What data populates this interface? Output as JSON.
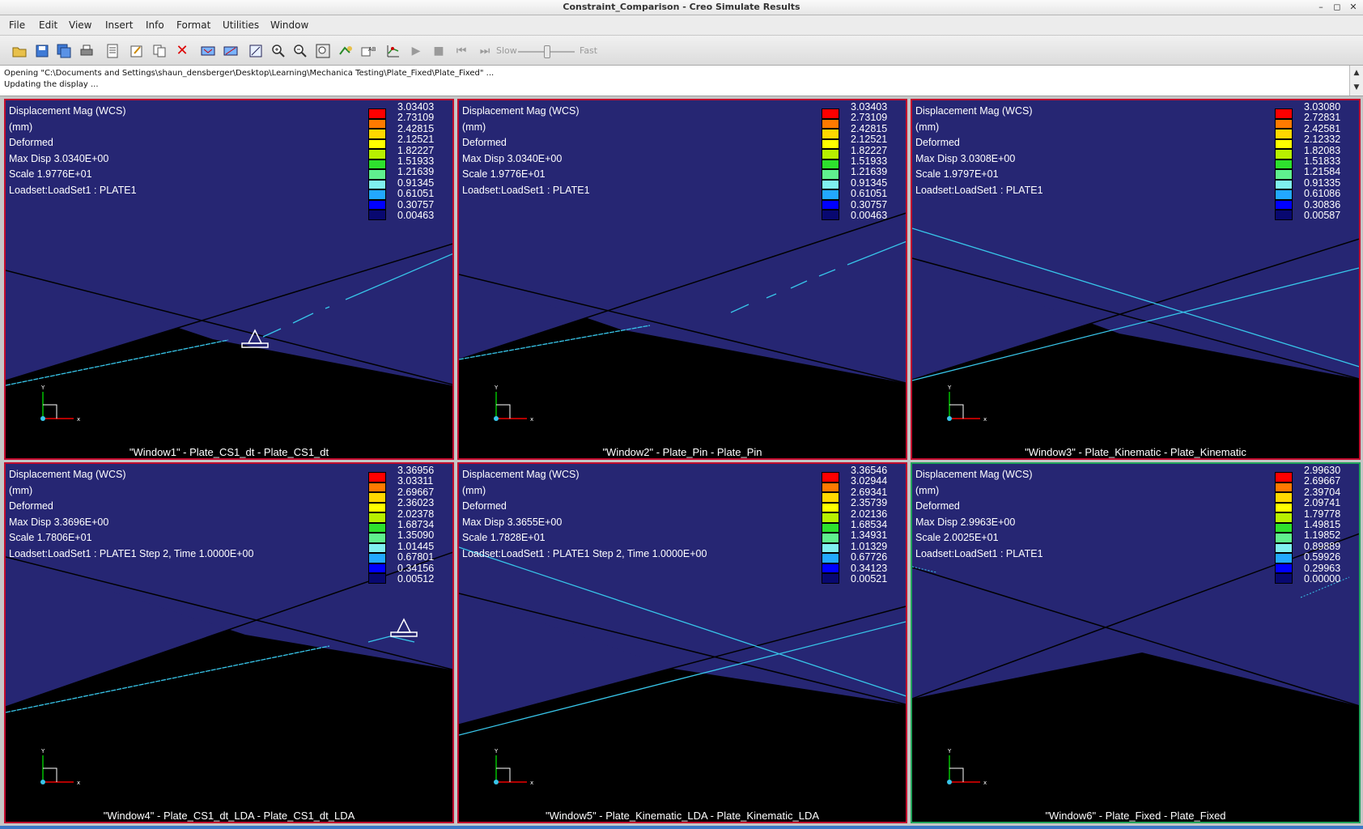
{
  "window": {
    "title": "Constraint_Comparison - Creo Simulate Results",
    "minimize": "–",
    "maximize": "◻",
    "close": "✕"
  },
  "menu": [
    "File",
    "Edit",
    "View",
    "Insert",
    "Info",
    "Format",
    "Utilities",
    "Window"
  ],
  "toolbar": {
    "slow_label": "Slow",
    "fast_label": "Fast",
    "icons": [
      "open-icon",
      "save-icon",
      "save-all-icon",
      "print-icon",
      "report-icon",
      "edit-definition-icon",
      "copy-icon",
      "delete-icon",
      "query-icon",
      "dynamic-query-icon",
      "info-icon",
      "zoom-in-icon",
      "zoom-out-icon",
      "refit-icon",
      "view-icon",
      "annotation-icon",
      "graph-icon",
      "play-icon",
      "stop-icon",
      "step-back-icon",
      "step-forward-icon"
    ]
  },
  "messages": [
    "Opening \"C:\\Documents and Settings\\shaun_densberger\\Desktop\\Learning\\Mechanica Testing\\Plate_Fixed\\Plate_Fixed\" ...",
    "Updating the display ..."
  ],
  "legend_colors": [
    "#ff0000",
    "#ff7a00",
    "#ffd800",
    "#ffff00",
    "#b8f000",
    "#2ee02e",
    "#5ff08e",
    "#7ff0f0",
    "#22a8ff",
    "#0000ff",
    "#080870"
  ],
  "panes": [
    {
      "title": "Displacement Mag (WCS)",
      "units": "(mm)",
      "state": "Deformed",
      "max_disp": "Max Disp  3.0340E+00",
      "scale": "Scale  1.9776E+01",
      "loadset": "Loadset:LoadSet1 :  PLATE1",
      "legend": [
        "3.03403",
        "2.73109",
        "2.42815",
        "2.12521",
        "1.82227",
        "1.51933",
        "1.21639",
        "0.91345",
        "0.61051",
        "0.30757",
        "0.00463"
      ],
      "caption": "\"Window1\" - Plate_CS1_dt - Plate_CS1_dt",
      "axis_x": "x",
      "axis_y": "Y"
    },
    {
      "title": "Displacement Mag (WCS)",
      "units": "(mm)",
      "state": "Deformed",
      "max_disp": "Max Disp  3.0340E+00",
      "scale": "Scale  1.9776E+01",
      "loadset": "Loadset:LoadSet1 :  PLATE1",
      "legend": [
        "3.03403",
        "2.73109",
        "2.42815",
        "2.12521",
        "1.82227",
        "1.51933",
        "1.21639",
        "0.91345",
        "0.61051",
        "0.30757",
        "0.00463"
      ],
      "caption": "\"Window2\" - Plate_Pin - Plate_Pin",
      "axis_x": "x",
      "axis_y": "Y"
    },
    {
      "title": "Displacement Mag (WCS)",
      "units": "(mm)",
      "state": "Deformed",
      "max_disp": "Max Disp  3.0308E+00",
      "scale": "Scale  1.9797E+01",
      "loadset": "Loadset:LoadSet1 :  PLATE1",
      "legend": [
        "3.03080",
        "2.72831",
        "2.42581",
        "2.12332",
        "1.82083",
        "1.51833",
        "1.21584",
        "0.91335",
        "0.61086",
        "0.30836",
        "0.00587"
      ],
      "caption": "\"Window3\" - Plate_Kinematic - Plate_Kinematic",
      "axis_x": "x",
      "axis_y": "Y"
    },
    {
      "title": "Displacement Mag (WCS)",
      "units": "(mm)",
      "state": "Deformed",
      "max_disp": "Max Disp  3.3696E+00",
      "scale": "Scale  1.7806E+01",
      "loadset": "Loadset:LoadSet1 :  PLATE1 Step 2, Time  1.0000E+00",
      "legend": [
        "3.36956",
        "3.03311",
        "2.69667",
        "2.36023",
        "2.02378",
        "1.68734",
        "1.35090",
        "1.01445",
        "0.67801",
        "0.34156",
        "0.00512"
      ],
      "caption": "\"Window4\" - Plate_CS1_dt_LDA - Plate_CS1_dt_LDA",
      "axis_x": "x",
      "axis_y": "Y"
    },
    {
      "title": "Displacement Mag (WCS)",
      "units": "(mm)",
      "state": "Deformed",
      "max_disp": "Max Disp  3.3655E+00",
      "scale": "Scale  1.7828E+01",
      "loadset": "Loadset:LoadSet1 :  PLATE1 Step 2, Time  1.0000E+00",
      "legend": [
        "3.36546",
        "3.02944",
        "2.69341",
        "2.35739",
        "2.02136",
        "1.68534",
        "1.34931",
        "1.01329",
        "0.67726",
        "0.34123",
        "0.00521"
      ],
      "caption": "\"Window5\" - Plate_Kinematic_LDA - Plate_Kinematic_LDA",
      "axis_x": "x",
      "axis_y": "Y"
    },
    {
      "title": "Displacement Mag (WCS)",
      "units": "(mm)",
      "state": "Deformed",
      "max_disp": "Max Disp  2.9963E+00",
      "scale": "Scale  2.0025E+01",
      "loadset": "Loadset:LoadSet1 :  PLATE1",
      "legend": [
        "2.99630",
        "2.69667",
        "2.39704",
        "2.09741",
        "1.79778",
        "1.49815",
        "1.19852",
        "0.89889",
        "0.59926",
        "0.29963",
        "0.00000"
      ],
      "caption": "\"Window6\" - Plate_Fixed - Plate_Fixed",
      "axis_x": "x",
      "axis_y": "Y"
    }
  ]
}
